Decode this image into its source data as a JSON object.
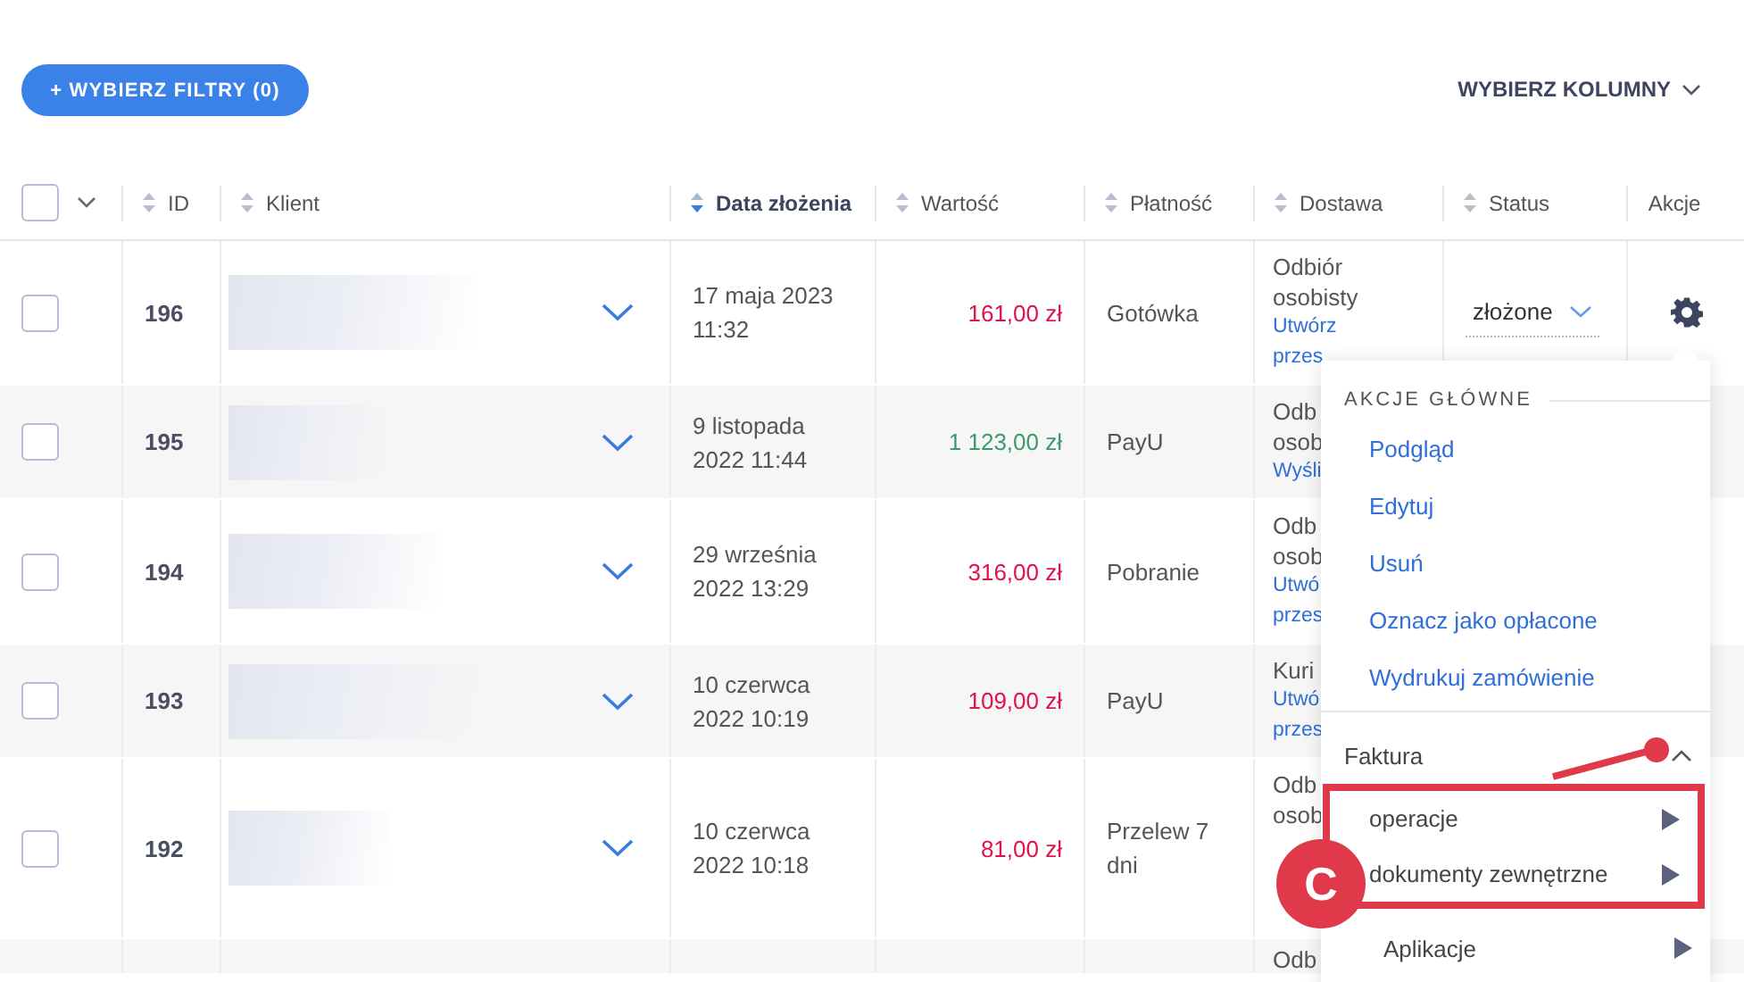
{
  "toolbar": {
    "filter_button": "+ WYBIERZ FILTRY (0)",
    "columns_button": "WYBIERZ KOLUMNY"
  },
  "columns": [
    {
      "label": "ID",
      "sorted": false
    },
    {
      "label": "Klient",
      "sorted": false
    },
    {
      "label": "Data złożenia",
      "sorted": true
    },
    {
      "label": "Wartość",
      "sorted": false
    },
    {
      "label": "Płatność",
      "sorted": false
    },
    {
      "label": "Dostawa",
      "sorted": false
    },
    {
      "label": "Status",
      "sorted": false
    },
    {
      "label": "Akcje"
    }
  ],
  "select_all": {
    "checked": false
  },
  "rows": [
    {
      "checked": false,
      "id": "196",
      "client": {
        "blurred": true
      },
      "date": [
        "17 maja 2023",
        "11:32"
      ],
      "amount": "161,00 zł",
      "paid": false,
      "payment": "Gotówka",
      "delivery": [
        "Odbiór",
        "osobisty"
      ],
      "delivery_link": [
        "Utwórz",
        "przes"
      ],
      "status": "złożone",
      "actions": true
    },
    {
      "checked": false,
      "id": "195",
      "client": {
        "blurred": true
      },
      "date": [
        "9 listopada",
        "2022 11:44"
      ],
      "amount": "1 123,00 zł",
      "paid": true,
      "payment": "PayU",
      "delivery": [
        "Odb",
        "osob"
      ],
      "delivery_link": [
        "Wyśli"
      ]
    },
    {
      "checked": false,
      "id": "194",
      "client": {
        "blurred": true
      },
      "date": [
        "29 września",
        "2022 13:29"
      ],
      "amount": "316,00 zł",
      "paid": false,
      "payment": "Pobranie",
      "delivery": [
        "Odb",
        "osob"
      ],
      "delivery_link": [
        "Utwó",
        "przes"
      ]
    },
    {
      "checked": false,
      "id": "193",
      "client": {
        "blurred": true
      },
      "date": [
        "10 czerwca",
        "2022 10:19"
      ],
      "amount": "109,00 zł",
      "paid": false,
      "payment": "PayU",
      "delivery": [
        "Kuri"
      ],
      "delivery_link": [
        "Utwó",
        "przes"
      ]
    },
    {
      "checked": false,
      "id": "192",
      "client": {
        "blurred": true
      },
      "date": [
        "10 czerwca",
        "2022 10:18"
      ],
      "amount": "81,00 zł",
      "paid": false,
      "payment": "Przelew 7 dni",
      "delivery": [
        "Odb",
        "osob"
      ]
    },
    {
      "delivery": [
        "Odb"
      ]
    }
  ],
  "actions_menu": {
    "heading": "AKCJE GŁÓWNE",
    "items": [
      {
        "label": "Podgląd"
      },
      {
        "label": "Edytuj"
      },
      {
        "label": "Usuń"
      },
      {
        "label": "Oznacz jako opłacone"
      },
      {
        "label": "Wydrukuj zamówienie"
      }
    ],
    "groups": [
      {
        "label": "Faktura",
        "expanded": true,
        "children": [
          {
            "label": "operacje"
          },
          {
            "label": "dokumenty zewnętrzne"
          }
        ]
      },
      {
        "label": "Aplikacje",
        "expanded": false
      }
    ]
  },
  "annotation": {
    "label": "C"
  }
}
